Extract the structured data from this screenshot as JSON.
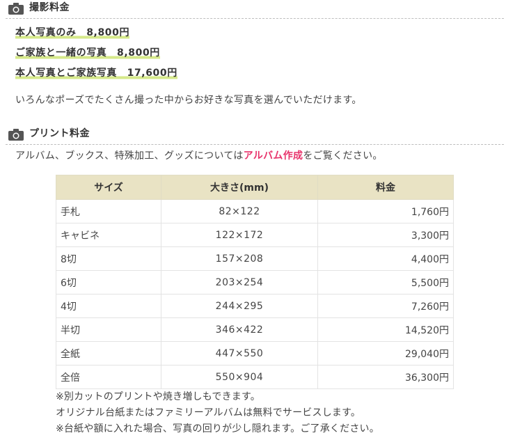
{
  "section1": {
    "title": "撮影料金",
    "prices": [
      "本人写真のみ　8,800円",
      "ご家族と一緒の写真　8,800円",
      "本人写真とご家族写真　17,600円"
    ],
    "description": "いろんなポーズでたくさん撮った中からお好きな写真を選んでいただけます。"
  },
  "section2": {
    "title": "プリント料金",
    "intro_before": "アルバム、ブックス、特殊加工、グッズについては",
    "intro_link": "アルバム作成",
    "intro_after": "をご覧ください。"
  },
  "table": {
    "headers": [
      "サイズ",
      "大きさ(mm)",
      "料金"
    ],
    "rows": [
      {
        "size": "手札",
        "dim": "82×122",
        "price": "1,760円"
      },
      {
        "size": "キャビネ",
        "dim": "122×172",
        "price": "3,300円"
      },
      {
        "size": "8切",
        "dim": "157×208",
        "price": "4,400円"
      },
      {
        "size": "6切",
        "dim": "203×254",
        "price": "5,500円"
      },
      {
        "size": "4切",
        "dim": "244×295",
        "price": "7,260円"
      },
      {
        "size": "半切",
        "dim": "346×422",
        "price": "14,520円"
      },
      {
        "size": "全紙",
        "dim": "447×550",
        "price": "29,040円"
      },
      {
        "size": "全倍",
        "dim": "550×904",
        "price": "36,300円"
      }
    ]
  },
  "notes": [
    "※別カットのプリントや焼き増しもできます。",
    "オリジナル台紙またはファミリーアルバムは無料でサービスします。",
    "※台紙や額に入れた場合、写真の回りが少し隠れます。ご了承ください。"
  ],
  "colors": {
    "highlight": "#d6e98a",
    "table_header": "#e9e3c4",
    "link": "#e8336b"
  }
}
